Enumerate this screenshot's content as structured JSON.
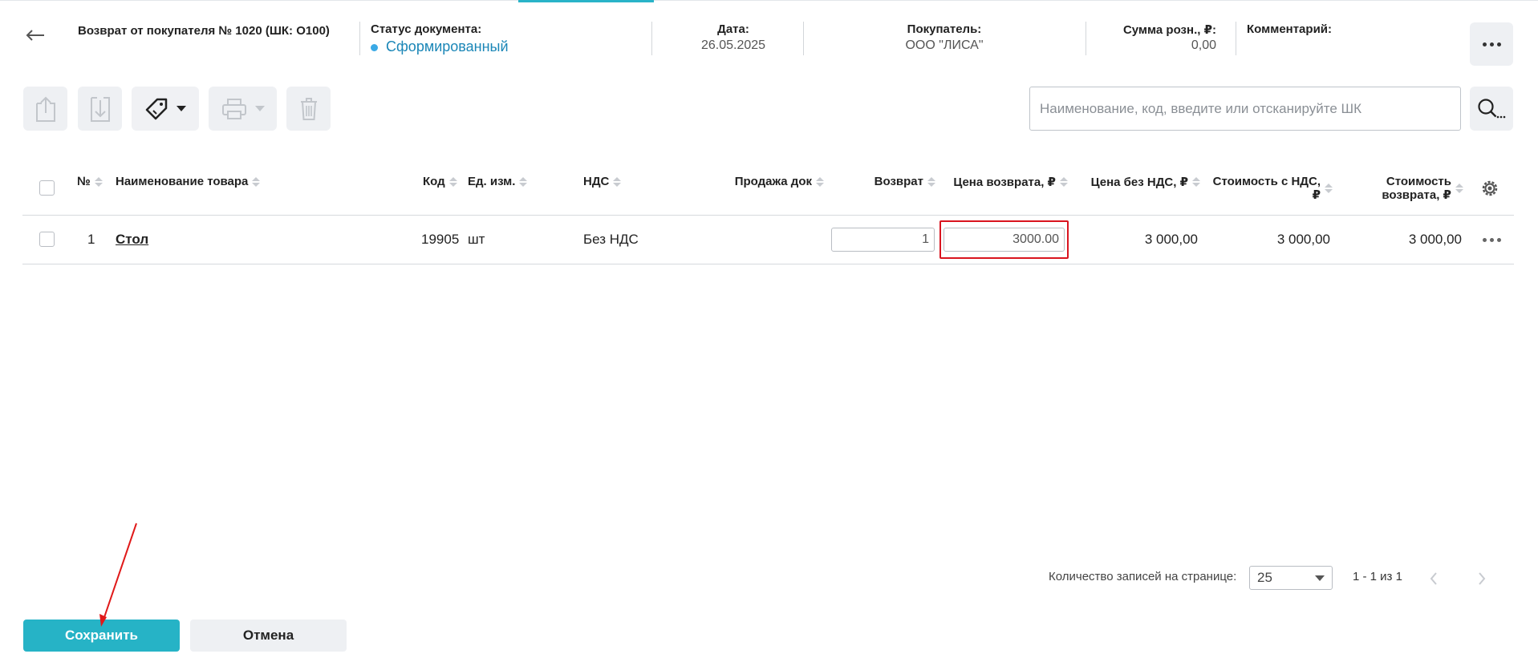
{
  "header": {
    "doc_title": "Возврат от покупателя № 1020 (ШК: О100)",
    "status_label": "Статус документа:",
    "status_value": "Сформированный",
    "date_label": "Дата:",
    "date_value": "26.05.2025",
    "buyer_label": "Покупатель:",
    "buyer_value": "ООО \"ЛИСА\"",
    "sum_label": "Сумма розн., ₽:",
    "sum_value": "0,00",
    "comment_label": "Комментарий:"
  },
  "icons": {
    "back": "arrow-left-icon",
    "more": "more-horizontal-icon",
    "export": "upload-file-icon",
    "import": "download-file-icon",
    "tag": "price-tag-icon",
    "print": "printer-icon",
    "delete": "trash-icon",
    "search": "search-icon",
    "settings": "gear-icon"
  },
  "toolbar": {
    "search_placeholder": "Наименование, код, введите или отсканируйте ШК"
  },
  "table": {
    "columns": {
      "num": "№",
      "name": "Наименование товара",
      "code": "Код",
      "unit": "Ед. изм.",
      "vat": "НДС",
      "sale_doc": "Продажа док",
      "return_qty": "Возврат",
      "return_price": "Цена возврата, ₽",
      "price_no_vat": "Цена без НДС, ₽",
      "cost_vat_l1": "Стоимость с НДС,",
      "cost_vat_l2": "₽",
      "cost_return_l1": "Стоимость",
      "cost_return_l2": "возврата, ₽"
    },
    "rows": [
      {
        "num": "1",
        "name": "Стол",
        "code": "19905",
        "unit": "шт",
        "vat": "Без НДС",
        "sale_doc": "",
        "return_qty": "1",
        "return_price": "3000.00",
        "price_no_vat": "3 000,00",
        "cost_vat": "3 000,00",
        "cost_return": "3 000,00"
      }
    ]
  },
  "pagination": {
    "per_page_label": "Количество записей на странице:",
    "per_page_value": "25",
    "range": "1 - 1 из 1"
  },
  "footer": {
    "save_label": "Сохранить",
    "cancel_label": "Отмена"
  },
  "colors": {
    "accent": "#26b3c6",
    "status_dot": "#3aa9e5",
    "status_text": "#1a86b7",
    "highlight_box": "#d9141f",
    "annotation_arrow": "#e01919"
  }
}
